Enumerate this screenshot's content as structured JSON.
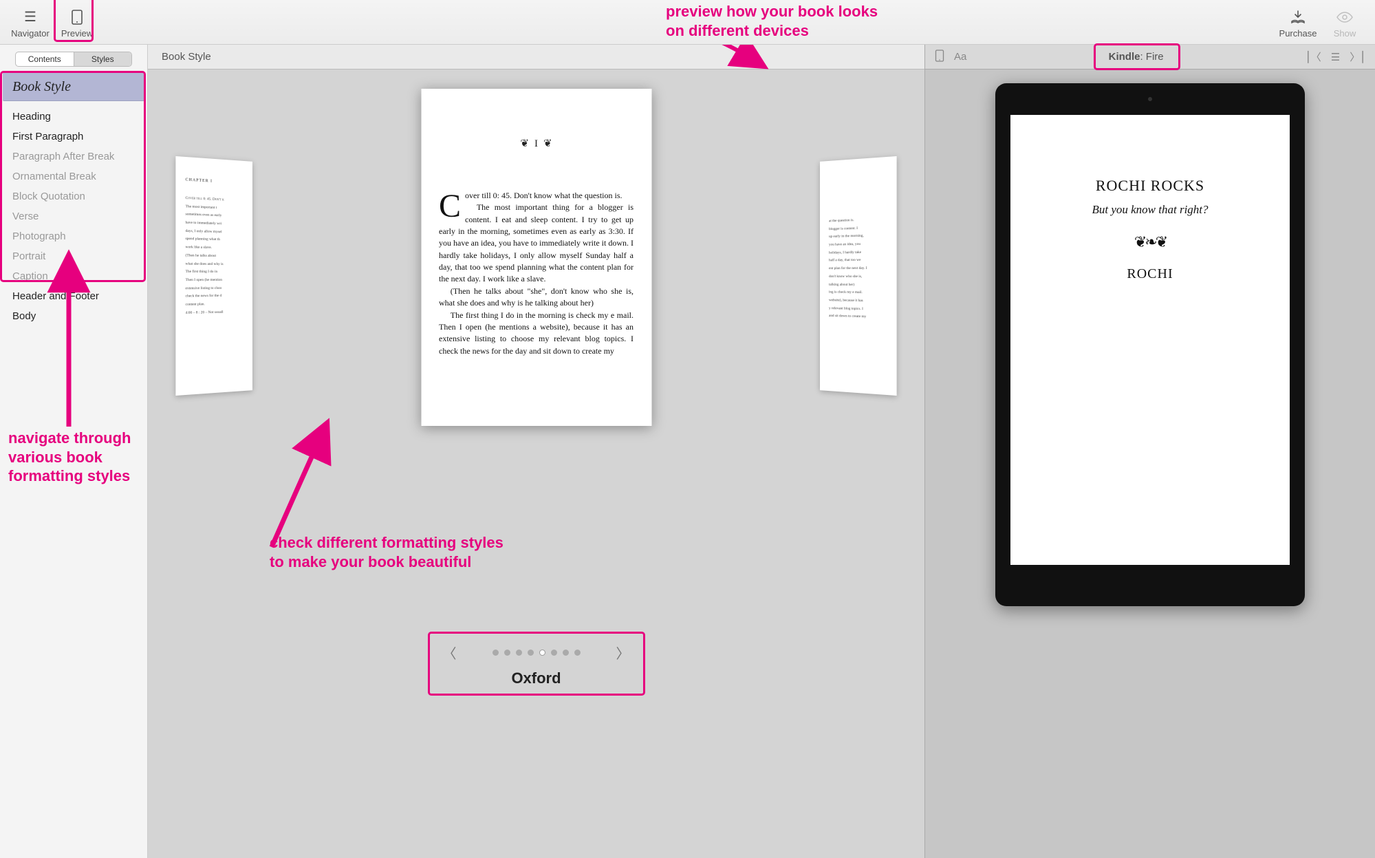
{
  "toolbar": {
    "navigator_label": "Navigator",
    "preview_label": "Preview",
    "purchase_label": "Purchase",
    "show_label": "Show"
  },
  "sidebar": {
    "segments": {
      "contents": "Contents",
      "styles": "Styles",
      "active": "styles"
    },
    "header": "Book Style",
    "items": [
      {
        "label": "Heading",
        "strong": true
      },
      {
        "label": "First Paragraph",
        "strong": true
      },
      {
        "label": "Paragraph After Break",
        "strong": false
      },
      {
        "label": "Ornamental Break",
        "strong": false
      },
      {
        "label": "Block Quotation",
        "strong": false
      },
      {
        "label": "Verse",
        "strong": false
      },
      {
        "label": "Photograph",
        "strong": false
      },
      {
        "label": "Portrait",
        "strong": false
      },
      {
        "label": "Caption",
        "strong": false
      },
      {
        "label": "Header and Footer",
        "strong": true
      },
      {
        "label": "Body",
        "strong": true
      }
    ]
  },
  "center": {
    "header": "Book Style",
    "chapter_number": "I",
    "para1": "over till 0: 45. Don't know what the question is.",
    "para1_dropcap": "C",
    "para2": "The most important thing for a blogger is content. I eat and sleep content. I try to get up early in the morning, sometimes even as early as 3:30. If you have an idea, you have to immediately write it down. I hardly take holidays, I only allow myself Sunday half a day, that too we spend planning what the content plan for the next day. I work like a slave.",
    "para3": "(Then he talks about \"she\", don't know who she is, what she does and why is he talking about her)",
    "para4": "The first thing I do in the morning is check my e mail. Then I open (he mentions a website), because it has an extensive listing to choose my relevant blog topics. I check the news for the day and sit down to create my",
    "left_chapter_label": "CHAPTER I",
    "left_p1a": "Cover till 0: 45. Don't k",
    "left_p1b": "The most important t",
    "left_p2": "sometimes even as early",
    "left_p3": "have to immediately wri",
    "left_p4": "days, I only allow mysel",
    "left_p5": "spend planning what th",
    "left_p6": "work like a slave.",
    "left_p7": "(Then he talks about",
    "left_p8": "what she does and why is",
    "left_p9": "The first thing I do in",
    "left_p10": "Then I open (he mention",
    "left_p11": "extensive listing to choo",
    "left_p12": "check the news for the d",
    "left_p13": "content plan.",
    "left_p14": "4:00 – 8 : 20 – Not usuall",
    "right_p1": "at the question is.",
    "right_p2": "blogger is content. I",
    "right_p3": "up early in the morning,",
    "right_p4": "you have an idea, you",
    "right_p5": "holidays, I hardly take",
    "right_p6": "half a day, that too we",
    "right_p7": "ent plan for the next day. I",
    "right_p8": "don't know who she is,",
    "right_p9": "talking about her)",
    "right_p10": "ing is check my e mail.",
    "right_p11": "website), because it has",
    "right_p12": "y relevant blog topics. I",
    "right_p13": "and sit down to create my",
    "selector": {
      "name": "Oxford",
      "count": 8,
      "active_index": 4
    }
  },
  "device": {
    "label_prefix": "Kindle",
    "label_suffix": ": Fire",
    "title": "ROCHI ROCKS",
    "subtitle": "But you know that right?",
    "ornament": "❦❧❦",
    "author": "ROCHI"
  },
  "annotations": {
    "callout_device": "preview how your book looks on different devices",
    "callout_sidebar": "navigate through various book formatting styles",
    "callout_styles": "check different formatting styles to make your book beautiful"
  }
}
